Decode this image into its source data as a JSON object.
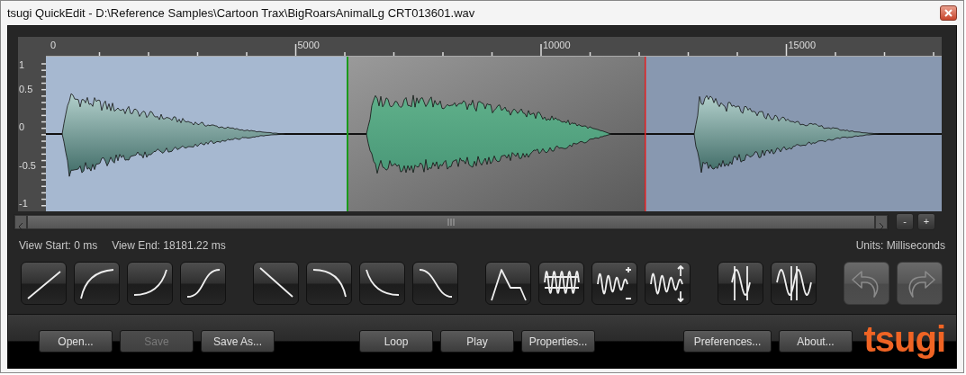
{
  "window": {
    "title": "tsugi QuickEdit - D:\\Reference Samples\\Cartoon Trax\\BigRoarsAnimalLg CRT013601.wav"
  },
  "ruler": {
    "labels": [
      "0",
      "5000",
      "10000",
      "15000"
    ]
  },
  "amplitude_axis": {
    "labels": [
      "1",
      "0.5",
      "0",
      "-0.5",
      "-1"
    ]
  },
  "zoom_buttons": [
    "-",
    "+"
  ],
  "info": {
    "view_start": "View Start: 0 ms",
    "view_end": "View End: 18181.22 ms",
    "units": "Units: Milliseconds"
  },
  "tool_groups": [
    {
      "buttons": [
        {
          "kind": "fade-in-linear",
          "disabled": false
        },
        {
          "kind": "fade-in-log",
          "disabled": false
        },
        {
          "kind": "fade-in-exp",
          "disabled": false
        },
        {
          "kind": "fade-in-s",
          "disabled": false
        }
      ]
    },
    {
      "buttons": [
        {
          "kind": "fade-out-linear",
          "disabled": false
        },
        {
          "kind": "fade-out-log",
          "disabled": false
        },
        {
          "kind": "fade-out-exp",
          "disabled": false
        },
        {
          "kind": "fade-out-s",
          "disabled": false
        }
      ]
    },
    {
      "buttons": [
        {
          "kind": "envelope",
          "disabled": false
        },
        {
          "kind": "normalize",
          "disabled": false
        },
        {
          "kind": "gain",
          "disabled": false
        },
        {
          "kind": "amplify",
          "disabled": false
        }
      ]
    },
    {
      "buttons": [
        {
          "kind": "loop-single",
          "disabled": false
        },
        {
          "kind": "loop-double",
          "disabled": false
        }
      ]
    },
    {
      "buttons": [
        {
          "kind": "undo",
          "disabled": true
        },
        {
          "kind": "redo",
          "disabled": true
        }
      ]
    }
  ],
  "button_groups": [
    {
      "buttons": [
        {
          "label": "Open...",
          "disabled": false
        },
        {
          "label": "Save",
          "disabled": true
        },
        {
          "label": "Save As...",
          "disabled": false
        }
      ]
    },
    {
      "buttons": [
        {
          "label": "Loop",
          "disabled": false
        },
        {
          "label": "Play",
          "disabled": false
        },
        {
          "label": "Properties...",
          "disabled": false
        }
      ]
    },
    {
      "buttons": [
        {
          "label": "Preferences...",
          "disabled": false
        },
        {
          "label": "About...",
          "disabled": false
        }
      ]
    }
  ],
  "logo": "tsugi"
}
